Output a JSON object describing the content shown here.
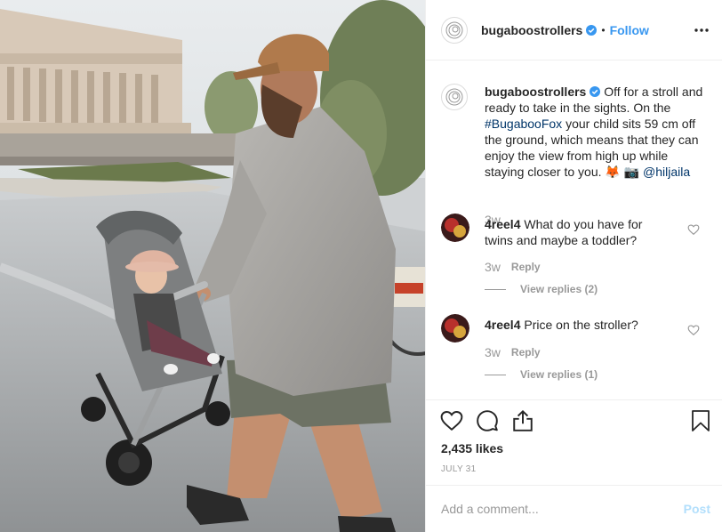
{
  "post": {
    "author": "bugaboostrollers",
    "follow_label": "Follow",
    "separator": "•",
    "more_icon": "more-horizontal-icon",
    "image_alt": "Man pushing a grey Bugaboo Fox stroller with a baby in a pink hat, in front of a columned building"
  },
  "caption": {
    "username": "bugaboostrollers",
    "text_1": " Off for a stroll and ready to take in the sights. On the ",
    "hashtag": "#BugabooFox",
    "text_2": " your child sits 59 cm off the ground, which means that they can enjoy the view from high up while staying closer to you. 🦊 📷 ",
    "mention": "@hiljaila",
    "time": "3w"
  },
  "comments": [
    {
      "username": "4reel4",
      "text": " What do you have for twins and maybe a toddler?",
      "time": "3w",
      "reply_label": "Reply",
      "view_replies": "View replies (2)"
    },
    {
      "username": "4reel4",
      "text": " Price on the stroller?",
      "time": "3w",
      "reply_label": "Reply",
      "view_replies": "View replies (1)"
    }
  ],
  "actions": {
    "icons": [
      "heart-icon",
      "comment-icon",
      "share-icon",
      "bookmark-icon"
    ],
    "likes": "2,435 likes",
    "date": "JULY 31"
  },
  "add_comment": {
    "placeholder": "Add a comment...",
    "post_label": "Post"
  },
  "colors": {
    "link_blue": "#3897f0",
    "hashtag": "#003569",
    "muted": "#999999",
    "post_disabled": "#b2dffc"
  }
}
